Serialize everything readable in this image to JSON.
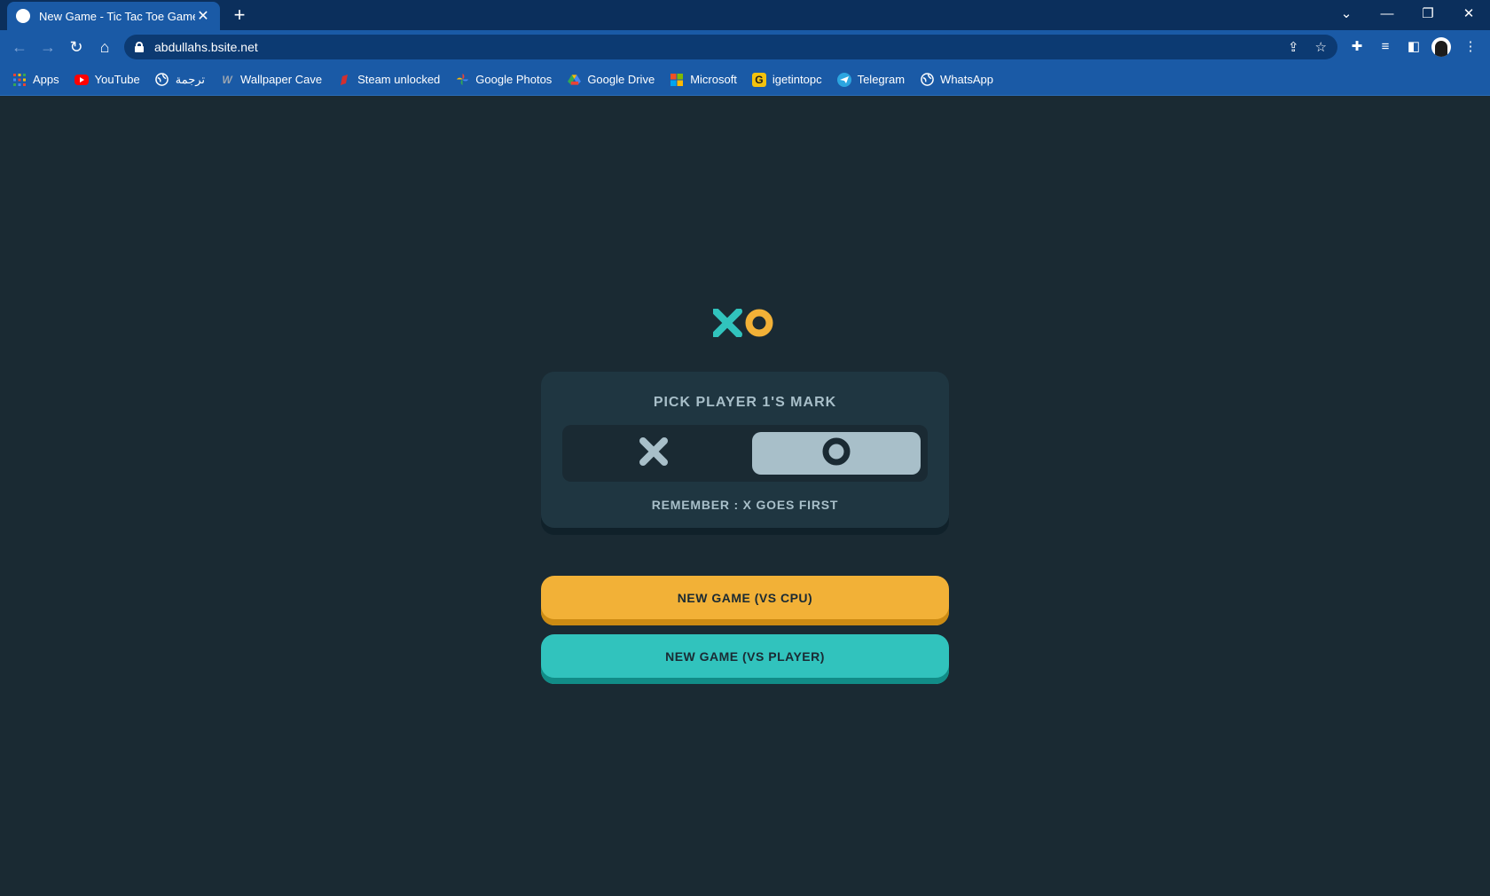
{
  "browser": {
    "tab": {
      "title": "New Game - Tic Tac Toe Game"
    },
    "address": {
      "url": "abdullahs.bsite.net"
    },
    "bookmarks": [
      {
        "label": "Apps",
        "icon": "apps-grid-icon"
      },
      {
        "label": "YouTube",
        "icon": "youtube-icon"
      },
      {
        "label": "ترجمة",
        "icon": "globe-icon"
      },
      {
        "label": "Wallpaper Cave",
        "icon": "wallpaper-cave-icon"
      },
      {
        "label": "Steam unlocked",
        "icon": "steam-unlocked-icon"
      },
      {
        "label": "Google Photos",
        "icon": "google-photos-icon"
      },
      {
        "label": "Google Drive",
        "icon": "google-drive-icon"
      },
      {
        "label": "Microsoft",
        "icon": "microsoft-icon"
      },
      {
        "label": "igetintopc",
        "icon": "igetintopc-icon"
      },
      {
        "label": "Telegram",
        "icon": "telegram-icon"
      },
      {
        "label": "WhatsApp",
        "icon": "globe-icon"
      }
    ]
  },
  "game": {
    "card": {
      "title": "PICK PLAYER 1'S MARK",
      "note": "REMEMBER : X GOES FIRST",
      "selected_mark": "O"
    },
    "buttons": {
      "vs_cpu": "NEW GAME (VS CPU)",
      "vs_player": "NEW GAME (VS PLAYER)"
    }
  },
  "colors": {
    "background": "#1a2a33",
    "card": "#1f3641",
    "silver": "#a8bfc9",
    "teal": "#31c3bd",
    "yellow": "#f2b137"
  }
}
